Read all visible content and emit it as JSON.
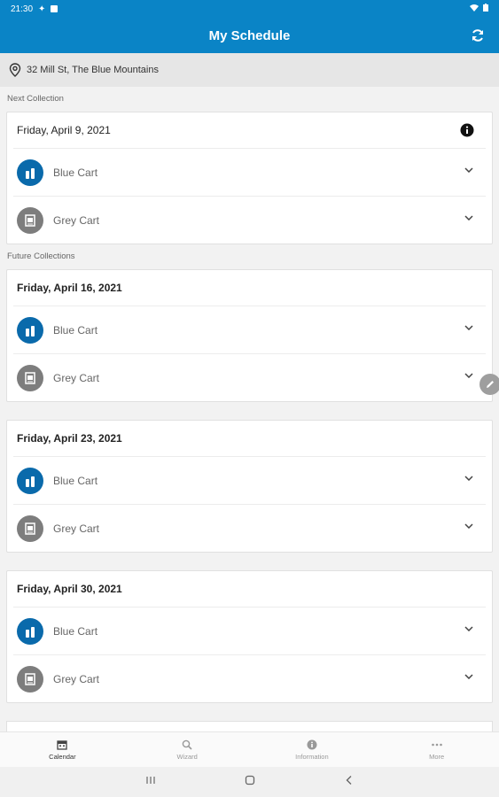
{
  "status_bar": {
    "time": "21:30"
  },
  "app_bar": {
    "title": "My Schedule",
    "refresh_icon": "refresh-icon"
  },
  "address": {
    "text": "32 Mill St, The Blue Mountains",
    "icon": "location-pin-icon"
  },
  "next_section_label": "Next Collection",
  "future_section_label": "Future Collections",
  "next_collection": {
    "date": "Friday, April 9, 2021",
    "items": [
      {
        "label": "Blue Cart",
        "icon": "blue-cart-icon"
      },
      {
        "label": "Grey Cart",
        "icon": "grey-cart-icon"
      }
    ]
  },
  "future_collections": [
    {
      "date": "Friday, April 16, 2021",
      "items": [
        {
          "label": "Blue Cart"
        },
        {
          "label": "Grey Cart"
        }
      ]
    },
    {
      "date": "Friday, April 23, 2021",
      "items": [
        {
          "label": "Blue Cart"
        },
        {
          "label": "Grey Cart"
        }
      ]
    },
    {
      "date": "Friday, April 30, 2021",
      "items": [
        {
          "label": "Blue Cart"
        },
        {
          "label": "Grey Cart"
        }
      ]
    }
  ],
  "bottom_nav": [
    {
      "label": "Calendar",
      "icon": "calendar-icon",
      "active": true
    },
    {
      "label": "Wizard",
      "icon": "search-icon",
      "active": false
    },
    {
      "label": "Information",
      "icon": "info-icon",
      "active": false
    },
    {
      "label": "More",
      "icon": "more-icon",
      "active": false
    }
  ],
  "colors": {
    "primary": "#0a84c6",
    "blue_cart": "#0a6aab",
    "grey_cart": "#7d7d7d"
  }
}
